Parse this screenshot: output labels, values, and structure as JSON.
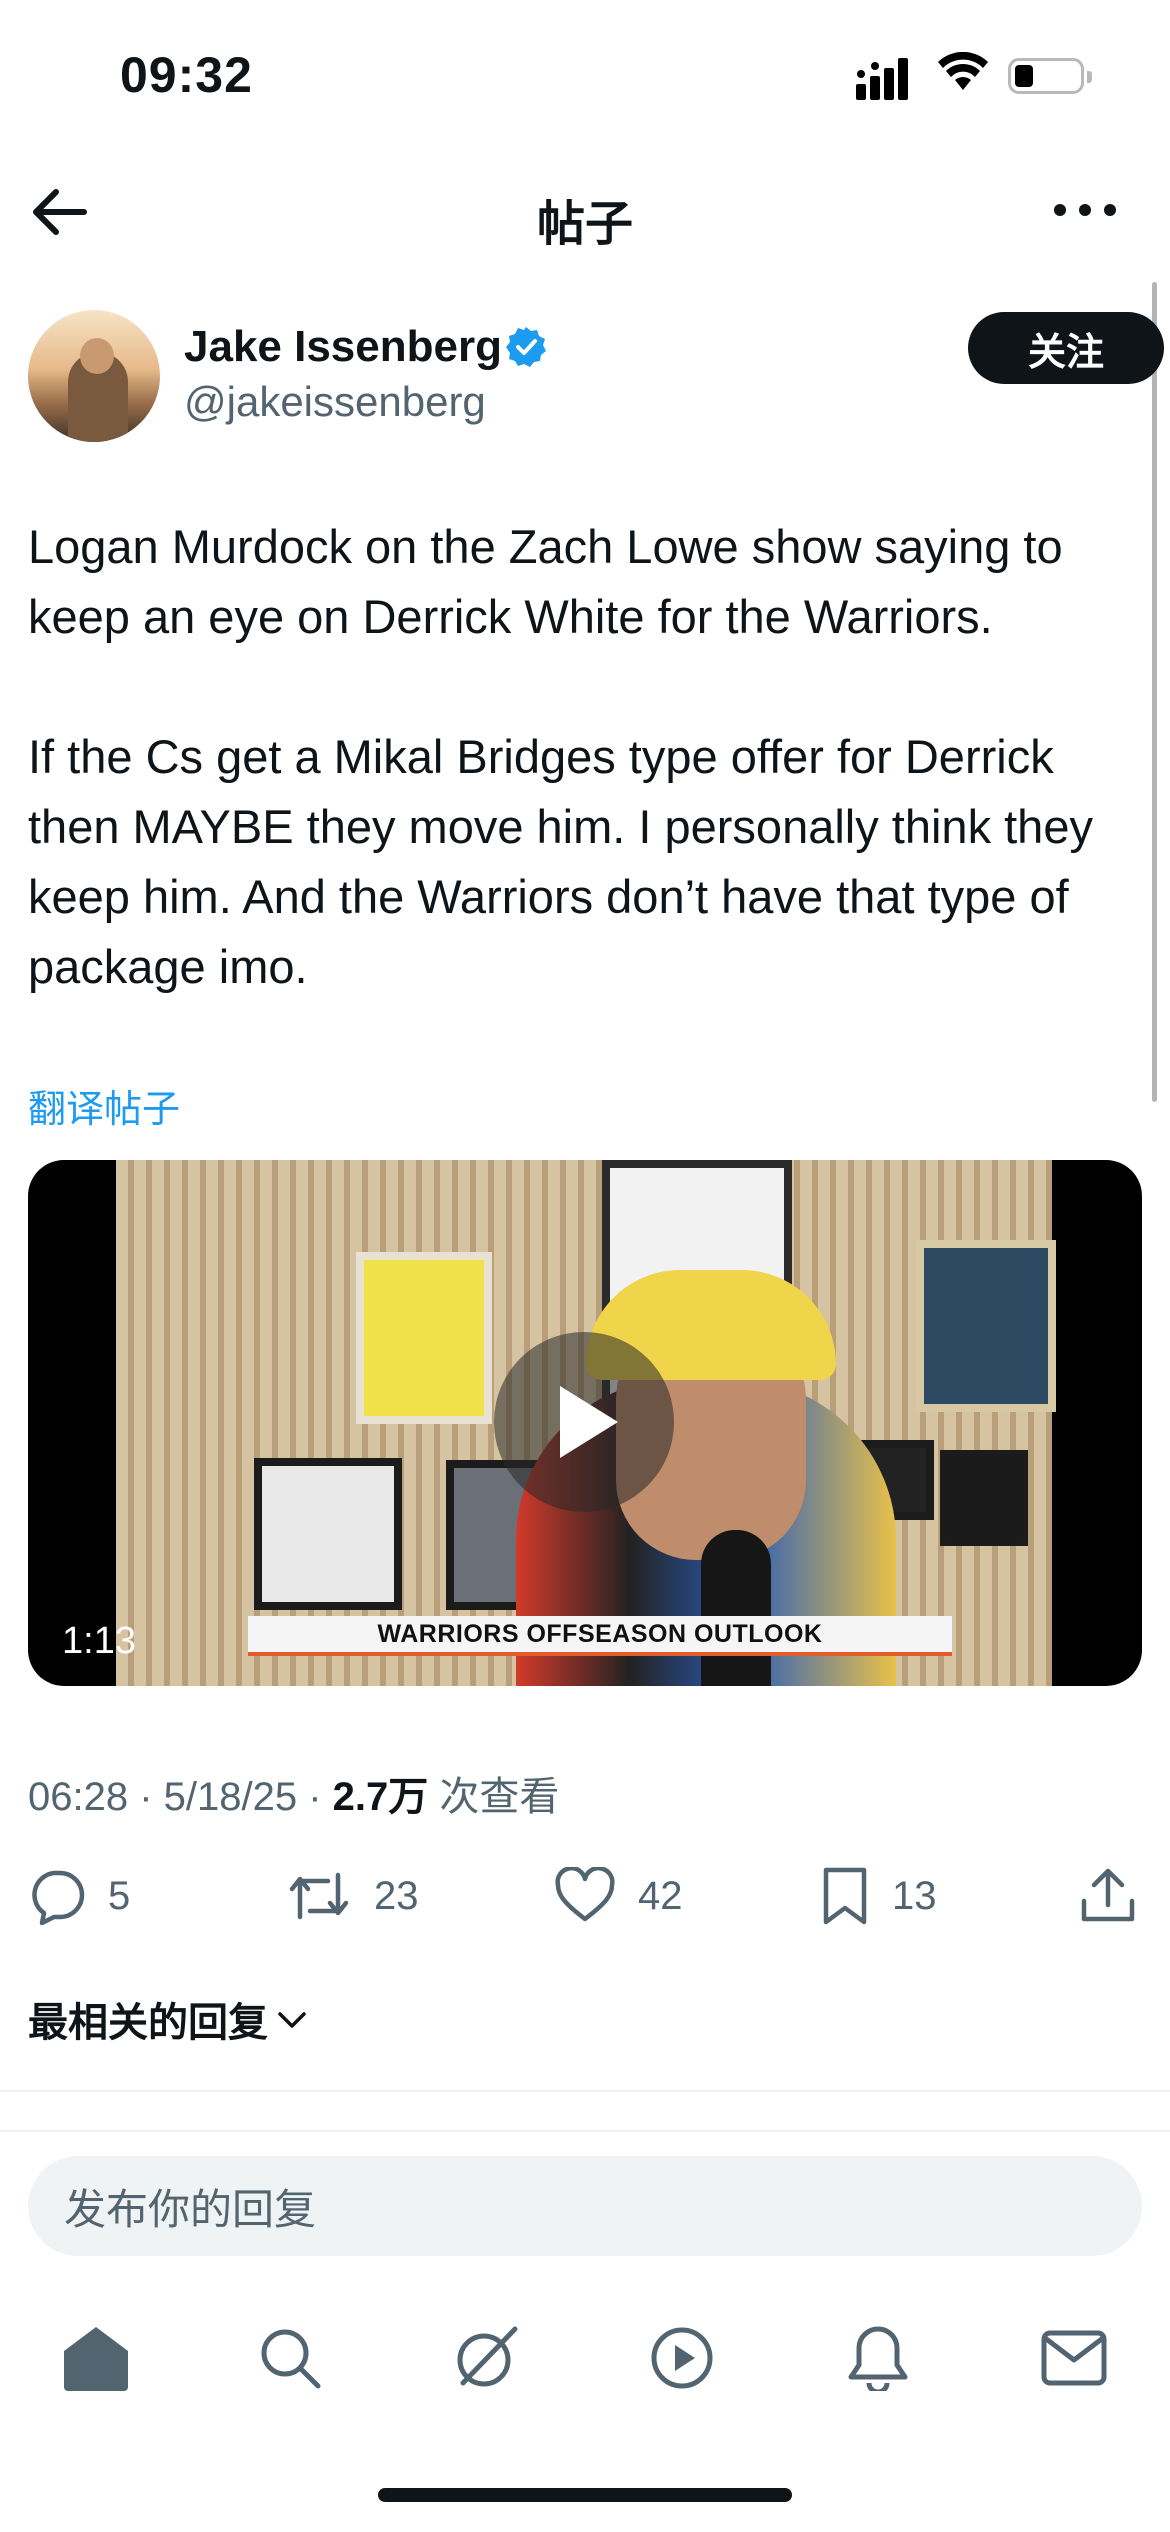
{
  "status_bar": {
    "time": "09:32"
  },
  "header": {
    "title": "帖子"
  },
  "post": {
    "author_name": "Jake Issenberg",
    "author_handle": "@jakeissenberg",
    "follow_label": "关注",
    "text": "Logan Murdock on the Zach Lowe show saying to keep an eye on Derrick White for the Warriors.\n\nIf the Cs get a Mikal Bridges type offer for Derrick then MAYBE they move him. I personally think they keep him. And the Warriors don’t have that type of package imo.",
    "translate_label": "翻译帖子",
    "video": {
      "duration": "1:13",
      "caption": "WARRIORS OFFSEASON OUTLOOK"
    },
    "meta": {
      "time": "06:28",
      "date": "5/18/25",
      "views": "2.7万",
      "views_label": "次查看"
    },
    "actions": {
      "replies": "5",
      "reposts": "23",
      "likes": "42",
      "bookmarks": "13"
    }
  },
  "replies_sort_label": "最相关的回复",
  "composer": {
    "placeholder": "发布你的回复"
  },
  "colors": {
    "accent": "#1d9bf0",
    "text": "#0f1419",
    "secondary": "#536471"
  },
  "tab_icons": [
    "home-icon",
    "search-icon",
    "grok-icon",
    "video-icon",
    "notifications-icon",
    "messages-icon"
  ]
}
